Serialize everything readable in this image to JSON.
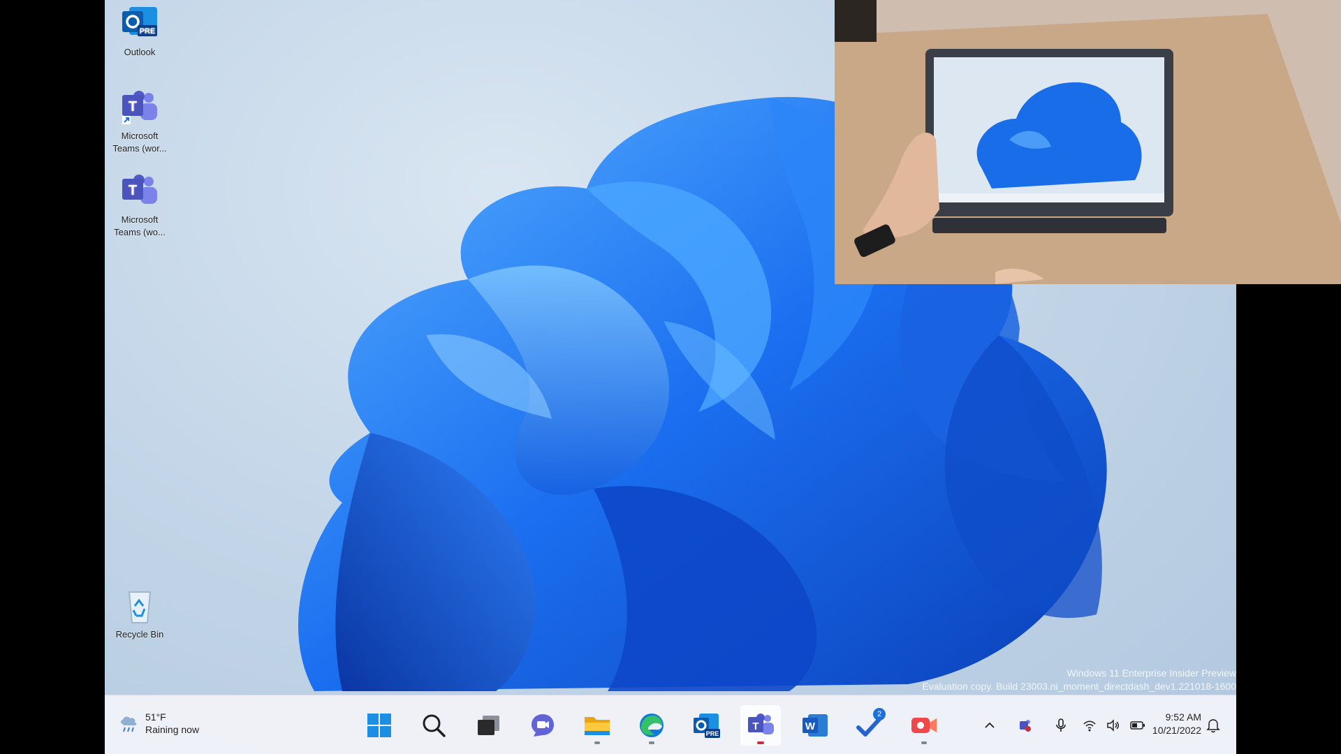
{
  "desktop": {
    "icons": [
      {
        "label": "Outlook",
        "badge": "PRE"
      },
      {
        "label": "Microsoft Teams (wor..."
      },
      {
        "label": "Microsoft Teams (wo..."
      },
      {
        "label": "Recycle Bin"
      }
    ]
  },
  "watermark": {
    "line1": "Windows 11 Enterprise Insider Preview",
    "line2": "Evaluation copy. Build 23003.ni_moment_directdash_dev1.221018-1600"
  },
  "taskbar": {
    "weather": {
      "temp": "51°F",
      "condition": "Raining now",
      "icon": "rain-cloud-icon"
    },
    "apps": [
      {
        "name": "start",
        "icon": "windows-logo-icon"
      },
      {
        "name": "search",
        "icon": "search-icon"
      },
      {
        "name": "task-view",
        "icon": "task-view-icon"
      },
      {
        "name": "chat",
        "icon": "chat-icon"
      },
      {
        "name": "file-explorer",
        "icon": "folder-icon",
        "running": true
      },
      {
        "name": "edge",
        "icon": "edge-icon",
        "running": true
      },
      {
        "name": "outlook",
        "icon": "outlook-icon",
        "label": "PRE"
      },
      {
        "name": "teams",
        "icon": "teams-icon",
        "running": true,
        "active": true
      },
      {
        "name": "word",
        "icon": "word-icon",
        "label": "W"
      },
      {
        "name": "todo",
        "icon": "todo-check-icon",
        "badge": "2"
      },
      {
        "name": "clipchamp",
        "icon": "video-camera-icon",
        "running": true
      }
    ],
    "tray": {
      "icons": [
        "chevron-up-icon",
        "teams-tray-icon",
        "microphone-icon",
        "wifi-icon",
        "volume-icon",
        "battery-icon"
      ],
      "time": "9:52 AM",
      "date": "10/21/2022",
      "notification_icon": "notification-bell-icon"
    }
  },
  "colors": {
    "accent": "#1f6fd6",
    "bloom": "#1a6de8",
    "taskbar": "#f0f3f8"
  }
}
